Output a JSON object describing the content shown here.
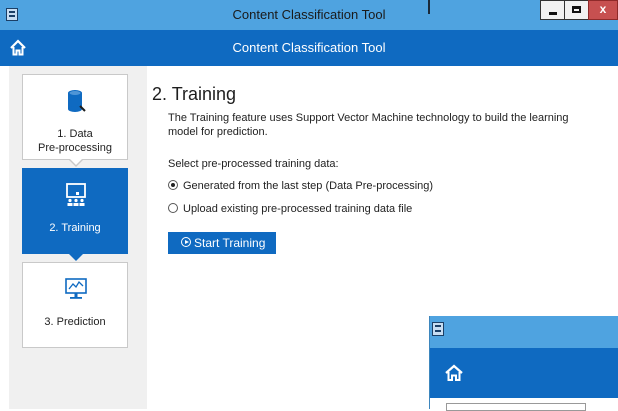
{
  "window": {
    "title": "Content Classification Tool",
    "controls": {
      "minimize": "minimize",
      "maximize": "maximize",
      "close": "x"
    }
  },
  "appbar": {
    "title": "Content Classification Tool",
    "home_icon": "home-icon"
  },
  "sidebar": {
    "steps": [
      {
        "label": "1. Data\nPre-processing",
        "icon": "database-icon",
        "active": false
      },
      {
        "label": "2. Training",
        "icon": "training-board-icon",
        "active": true
      },
      {
        "label": "3. Prediction",
        "icon": "monitor-chart-icon",
        "active": false
      }
    ]
  },
  "content": {
    "heading": "2. Training",
    "description": "The Training feature uses Support Vector Machine technology to build the learning model for prediction.",
    "select_prompt": "Select pre-processed training data:",
    "options": [
      {
        "label": "Generated from the last step (Data Pre-processing)",
        "checked": true
      },
      {
        "label": "Upload existing pre-processed training data file",
        "checked": false
      }
    ],
    "start_button": "Start Training"
  },
  "colors": {
    "accent": "#0f6ac1",
    "titlebar": "#4fa3e0",
    "close": "#c75050",
    "sidebar_bg": "#f0f0f0"
  }
}
